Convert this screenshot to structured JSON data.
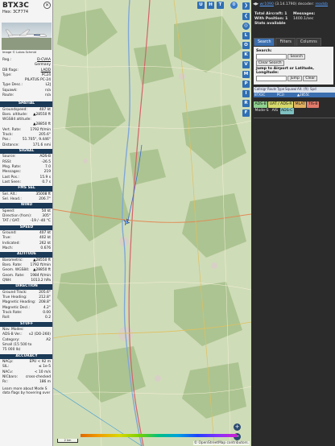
{
  "aircraft": {
    "callsign": "BTX3C",
    "hex": "Hex: 3CF774",
    "photo_credit": "Image © Lukas Schmid"
  },
  "info_rows": [
    {
      "k": "Reg.:",
      "v": "D-CVAA",
      "link": true
    },
    {
      "k": "",
      "v": "Germany"
    },
    {
      "k": "DB flags:",
      "v": "LADD",
      "link": true
    },
    {
      "k": "Type:",
      "v": "PC24"
    },
    {
      "k": "",
      "v": "PILATUS PC-24"
    },
    {
      "k": "Type Desc.:",
      "v": "L2J"
    },
    {
      "k": "Squawk:",
      "v": "n/a"
    },
    {
      "k": "Route:",
      "v": "n/a"
    }
  ],
  "sections": {
    "spatial": {
      "title": "SPATIAL",
      "rows": [
        {
          "k": "Groundspeed:",
          "v": "407 kt"
        },
        {
          "k": "Baro. altitude:",
          "v": "▲28550 ft"
        },
        {
          "k": "WGS84 altitude:",
          "v": ""
        },
        {
          "k": "",
          "v": "▲28850 ft"
        },
        {
          "k": "Vert. Rate:",
          "v": "1792 ft/min"
        },
        {
          "k": "Track:",
          "v": "205.6°"
        },
        {
          "k": "Pos.:",
          "v": "51.705°, 9.446°"
        },
        {
          "k": "Distance:",
          "v": "171.6 nmi"
        }
      ]
    },
    "signal": {
      "title": "SIGNAL",
      "rows": [
        {
          "k": "Source:",
          "v": "ADS-B"
        },
        {
          "k": "RSSI:",
          "v": "-26.5"
        },
        {
          "k": "Msg. Rate:",
          "v": "7.0"
        },
        {
          "k": "Messages:",
          "v": "219"
        },
        {
          "k": "Last Pos.:",
          "v": "15.9 s"
        },
        {
          "k": "Last Seen:",
          "v": "0.7 s"
        }
      ]
    },
    "fms": {
      "title": "FMS SEL",
      "rows": [
        {
          "k": "Sel. Alt.:",
          "v": "35008 ft"
        },
        {
          "k": "Sel. Head.:",
          "v": "206.7°"
        }
      ]
    },
    "wind": {
      "title": "WIND",
      "rows": [
        {
          "k": "Speed:",
          "v": "50 kt"
        },
        {
          "k": "Direction (from):",
          "v": "305°"
        },
        {
          "k": "TAT / OAT:",
          "v": "-19 / -40 °C"
        }
      ]
    },
    "speed": {
      "title": "SPEED",
      "rows": [
        {
          "k": "Ground:",
          "v": "407 kt"
        },
        {
          "k": "True:",
          "v": "402 kt"
        },
        {
          "k": "Indicated:",
          "v": "262 kt"
        },
        {
          "k": "Mach:",
          "v": "0.676"
        }
      ]
    },
    "altitude": {
      "title": "ALTITUDE",
      "rows": [
        {
          "k": "Barometric:",
          "v": "▲28550 ft"
        },
        {
          "k": "Baro. Rate:",
          "v": "1792 ft/min"
        },
        {
          "k": "Geom. WGS84:",
          "v": "▲28850 ft"
        },
        {
          "k": "Geom. Rate:",
          "v": "1984 ft/min"
        },
        {
          "k": "QNH:",
          "v": "1013.2 hPa"
        }
      ]
    },
    "direction": {
      "title": "DIRECTION",
      "rows": [
        {
          "k": "Ground Track:",
          "v": "205.6°"
        },
        {
          "k": "True Heading:",
          "v": "212.8°"
        },
        {
          "k": "Magnetic Heading:",
          "v": "208.8°"
        },
        {
          "k": "Magnetic Decl.:",
          "v": "4.2°"
        },
        {
          "k": "Track Rate:",
          "v": "0.00"
        },
        {
          "k": "Roll:",
          "v": "0.2"
        }
      ]
    },
    "stuff": {
      "title": "STUFF",
      "rows": [
        {
          "k": "Nav. Modes:",
          "v": ""
        },
        {
          "k": "ADS-B Ver.:",
          "v": "v2 (DO-260)"
        },
        {
          "k": "Category:",
          "v": "A2"
        },
        {
          "k": "Small (15 500 to",
          "v": ""
        },
        {
          "k": "75 000 lb)",
          "v": ""
        }
      ]
    },
    "accuracy": {
      "title": "ACCURACY",
      "rows": [
        {
          "k": "NACp:",
          "v": "EPU < 92 m"
        },
        {
          "k": "SIL:",
          "v": "≤ 1e-5"
        },
        {
          "k": "NACv:",
          "v": "< 10 m/s"
        },
        {
          "k": "NICbaro:",
          "v": "cross-checked"
        },
        {
          "k": "Rc:",
          "v": "186 m"
        }
      ]
    }
  },
  "footer_text": "Learn more about Mode S data flags by hovering over",
  "map": {
    "side_buttons": [
      "L",
      "O",
      "K",
      "V",
      "M",
      "P",
      "I",
      "R",
      "F"
    ],
    "top_buttons": [
      "U",
      "H",
      "T"
    ],
    "zoom_in": "+",
    "zoom_out": "−",
    "scale": "2 km",
    "attribution": "© OpenStreetMap contributors.",
    "accent": "#2f6fb5"
  },
  "right": {
    "version_link": "wr1090",
    "version_text": "(3.14.1790) decoder:",
    "version_tail": "readsb",
    "total_aircraft_label": "Total Aircraft: 1",
    "with_position_label": "With Position: 1",
    "stats_label": "Stats available",
    "messages_label": "Messages:",
    "messages_rate": "1400.1/sec",
    "tabs": [
      "Search",
      "Filters",
      "Columns"
    ],
    "search_label": "Search:",
    "search_button": "Search",
    "clear_search_button": "Clear Search",
    "jump_label": "Jump to Airport or Latitude, Longitude:",
    "jump_button": "Jump",
    "clear_button": "Clear",
    "columns": [
      "Callsign",
      "Route",
      "Type",
      "Squawk",
      "Alt. (ft)",
      "Spd"
    ],
    "row": [
      "BTX3C",
      "",
      "PC24",
      "",
      "▲28550",
      ""
    ],
    "chips": [
      {
        "label": "ADS-B",
        "color": "#8fd18f"
      },
      {
        "label": "UAT / ADS-R",
        "color": "#d6d96a"
      },
      {
        "label": "MLAT",
        "color": "#e0b060"
      },
      {
        "label": "TIS-B",
        "color": "#e07a6a"
      },
      {
        "label": "Mode-S",
        "color": "#2b2b2b"
      },
      {
        "label": "AIS",
        "color": "#2b2b2b"
      },
      {
        "label": "ADS-C",
        "color": "#7fc0c0"
      }
    ]
  },
  "legend_ticks": [
    "",
    "",
    "",
    "",
    "",
    "",
    "",
    "",
    ""
  ]
}
